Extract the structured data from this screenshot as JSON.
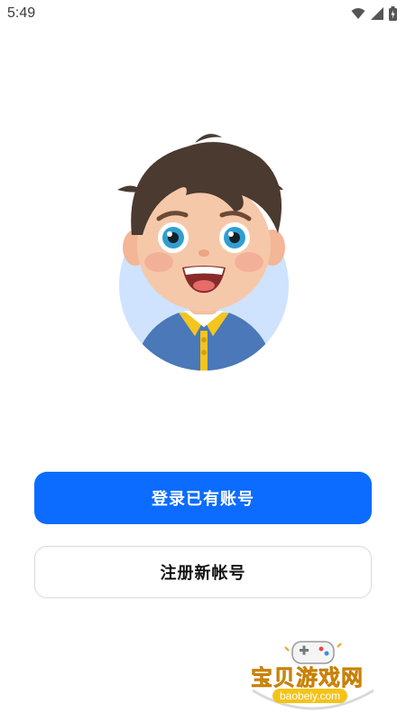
{
  "status_bar": {
    "time": "5:49",
    "icons": [
      "wifi-icon",
      "cellular-signal-icon",
      "battery-charging-icon"
    ]
  },
  "avatar": {
    "icon": "boy-avatar-illustration",
    "circle_color": "#cfe3ff"
  },
  "actions": {
    "login_label": "登录已有账号",
    "register_label": "注册新帐号"
  },
  "colors": {
    "primary": "#0b6cff",
    "secondary_border": "#d9d9d9"
  },
  "watermark": {
    "title": "宝贝游戏网",
    "url": "baobeiy.com"
  }
}
